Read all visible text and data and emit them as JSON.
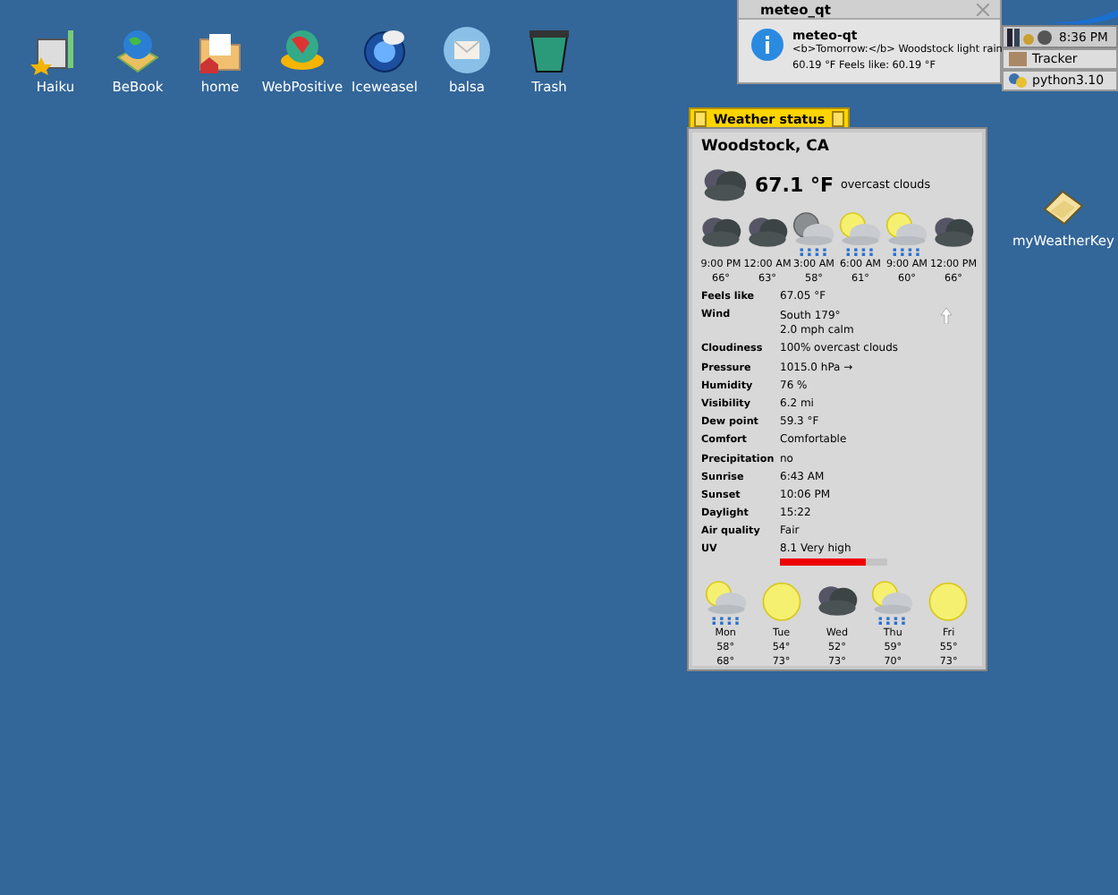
{
  "desktop_icons": [
    {
      "label": "Haiku",
      "kind": "volume"
    },
    {
      "label": "BeBook",
      "kind": "globe-book"
    },
    {
      "label": "home",
      "kind": "folder"
    },
    {
      "label": "WebPositive",
      "kind": "globe"
    },
    {
      "label": "Iceweasel",
      "kind": "browser"
    },
    {
      "label": "balsa",
      "kind": "mail"
    },
    {
      "label": "Trash",
      "kind": "trash"
    }
  ],
  "side_icon": {
    "label": "myWeatherKey",
    "kind": "note"
  },
  "notification": {
    "title": "meteo_qt",
    "heading": "meteo-qt",
    "lines": [
      "<b>Tomorrow:</b> Woodstock light rain",
      "60.19 °F Feels like: 60.19 °F"
    ]
  },
  "deskbar": {
    "time": "8:36 PM",
    "items": [
      "Tracker",
      "python3.10"
    ]
  },
  "weather": {
    "title": "Weather status",
    "location": "Woodstock, CA",
    "temperature": "67.1 °F",
    "condition": "overcast clouds",
    "hourly": [
      {
        "time": "9:00 PM",
        "temp": "66°",
        "kind": "cloud"
      },
      {
        "time": "12:00 AM",
        "temp": "63°",
        "kind": "cloud"
      },
      {
        "time": "3:00 AM",
        "temp": "58°",
        "kind": "moon-rain"
      },
      {
        "time": "6:00 AM",
        "temp": "61°",
        "kind": "sun-rain"
      },
      {
        "time": "9:00 AM",
        "temp": "60°",
        "kind": "sun-rain"
      },
      {
        "time": "12:00 PM",
        "temp": "66°",
        "kind": "cloud"
      }
    ],
    "details": [
      {
        "label": "Feels like",
        "values": [
          "67.05 °F"
        ]
      },
      {
        "label": "Wind",
        "values": [
          "South 179°",
          "2.0 mph calm"
        ]
      },
      {
        "label": "Cloudiness",
        "values": [
          "100% overcast clouds"
        ]
      },
      {
        "label": "Pressure",
        "values": [
          "1015.0 hPa →"
        ]
      },
      {
        "label": "Humidity",
        "values": [
          "76 %"
        ]
      },
      {
        "label": "Visibility",
        "values": [
          "6.2 mi"
        ]
      },
      {
        "label": "Dew point",
        "values": [
          "59.3 °F"
        ]
      },
      {
        "label": "Comfort",
        "values": [
          "Comfortable"
        ]
      },
      {
        "label": "Precipitation",
        "values": [
          "no"
        ]
      },
      {
        "label": "Sunrise",
        "values": [
          "6:43 AM"
        ]
      },
      {
        "label": "Sunset",
        "values": [
          "10:06 PM"
        ]
      },
      {
        "label": "Daylight",
        "values": [
          "15:22"
        ]
      },
      {
        "label": "Air quality",
        "values": [
          "Fair"
        ]
      },
      {
        "label": "UV",
        "values": [
          "8.1 Very high"
        ]
      }
    ],
    "uv": {
      "level": 0.8
    },
    "daily": [
      {
        "day": "Mon",
        "low": "58°",
        "high": "68°",
        "kind": "sun-rain"
      },
      {
        "day": "Tue",
        "low": "54°",
        "high": "73°",
        "kind": "sun"
      },
      {
        "day": "Wed",
        "low": "52°",
        "high": "73°",
        "kind": "cloud"
      },
      {
        "day": "Thu",
        "low": "59°",
        "high": "70°",
        "kind": "sun-rain"
      },
      {
        "day": "Fri",
        "low": "55°",
        "high": "73°",
        "kind": "sun"
      }
    ]
  }
}
